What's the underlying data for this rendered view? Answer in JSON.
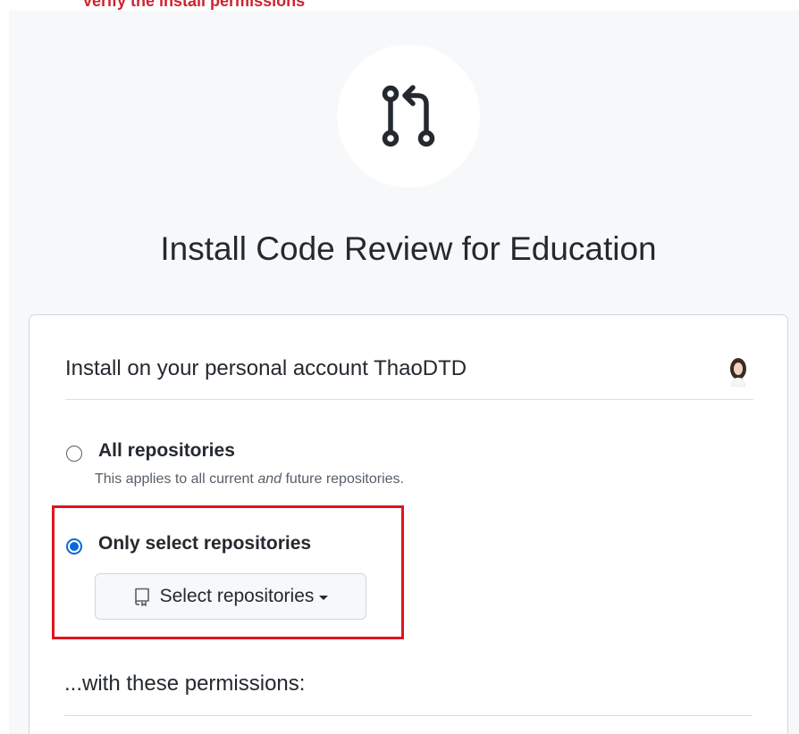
{
  "top_banner": {
    "text": "Verify the install permissions"
  },
  "app": {
    "title": "Install Code Review for Education",
    "logo_icon": "git-pull-request-icon"
  },
  "install": {
    "account_text": "Install on your personal account ThaoDTD",
    "avatar_icon": "user-avatar"
  },
  "options": {
    "all": {
      "label": "All repositories",
      "desc_before": "This applies to all current ",
      "desc_em": "and",
      "desc_after": " future repositories.",
      "selected": false
    },
    "select": {
      "label": "Only select repositories",
      "selected": true,
      "button_label": "Select repositories",
      "button_icon": "repo-icon"
    }
  },
  "permissions": {
    "heading": "...with these permissions:"
  },
  "colors": {
    "accent": "#0969da",
    "highlight": "#e0141e",
    "banner": "#cf222e"
  }
}
